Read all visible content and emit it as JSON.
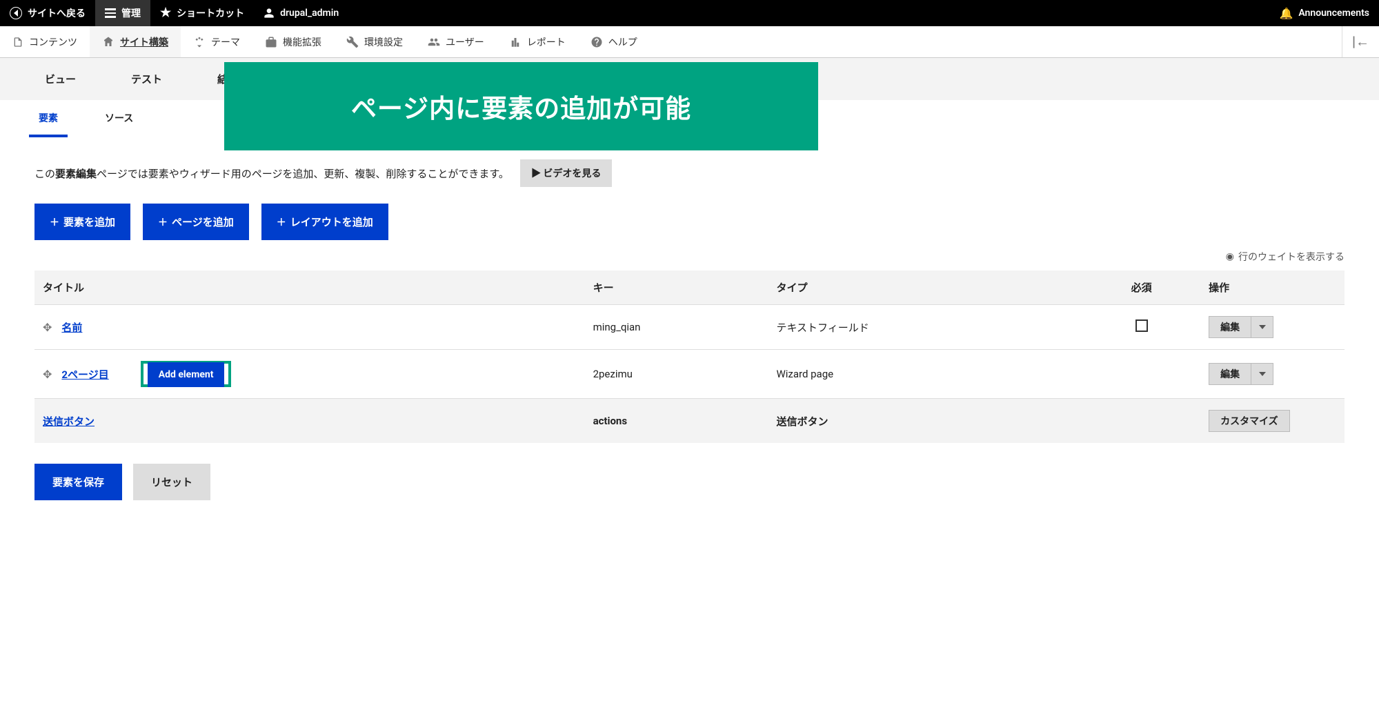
{
  "toolbar_top": {
    "back": "サイトへ戻る",
    "manage": "管理",
    "shortcut": "ショートカット",
    "user": "drupal_admin",
    "announcements": "Announcements"
  },
  "toolbar_sec": [
    {
      "label": "コンテンツ",
      "icon": "document-icon"
    },
    {
      "label": "サイト構築",
      "icon": "structure-icon",
      "active": true
    },
    {
      "label": "テーマ",
      "icon": "appearance-icon"
    },
    {
      "label": "機能拡張",
      "icon": "extend-icon"
    },
    {
      "label": "環境設定",
      "icon": "config-icon"
    },
    {
      "label": "ユーザー",
      "icon": "people-icon"
    },
    {
      "label": "レポート",
      "icon": "reports-icon"
    },
    {
      "label": "ヘルプ",
      "icon": "help-icon"
    }
  ],
  "overlay_banner": "ページ内に要素の追加が可能",
  "gray_tabs": [
    "ビュー",
    "テスト",
    "結"
  ],
  "sub_tabs": [
    {
      "label": "要素",
      "active": true
    },
    {
      "label": "ソース",
      "active": false
    }
  ],
  "help_text_prefix": "この",
  "help_text_bold": "要素編集",
  "help_text_suffix": "ページでは要素やウィザード用のページを追加、更新、複製、削除することができます。",
  "video_button": "▶ ビデオを見る",
  "add_buttons": {
    "element": "要素を追加",
    "page": "ページを追加",
    "layout": "レイアウトを追加"
  },
  "weight_toggle": "行のウェイトを表示する",
  "table": {
    "headers": {
      "title": "タイトル",
      "key": "キー",
      "type": "タイプ",
      "required": "必須",
      "ops": "操作"
    },
    "rows": [
      {
        "title": "名前",
        "key": "ming_qian",
        "type": "テキストフィールド",
        "required": true,
        "op": "編集",
        "has_caret": true,
        "indent": 0,
        "has_drag": true,
        "link": true
      },
      {
        "title": "2ページ目",
        "key": "2pezimu",
        "type": "Wizard page",
        "required": false,
        "op": "編集",
        "has_caret": true,
        "indent": 0,
        "has_drag": true,
        "link": true,
        "add_element": true
      },
      {
        "title": "送信ボタン",
        "key": "actions",
        "type": "送信ボタン",
        "required": false,
        "op": "カスタマイズ",
        "has_caret": false,
        "indent": 0,
        "has_drag": false,
        "link": true,
        "actions_row": true
      }
    ],
    "add_element_label": "Add element"
  },
  "bottom": {
    "save": "要素を保存",
    "reset": "リセット"
  }
}
